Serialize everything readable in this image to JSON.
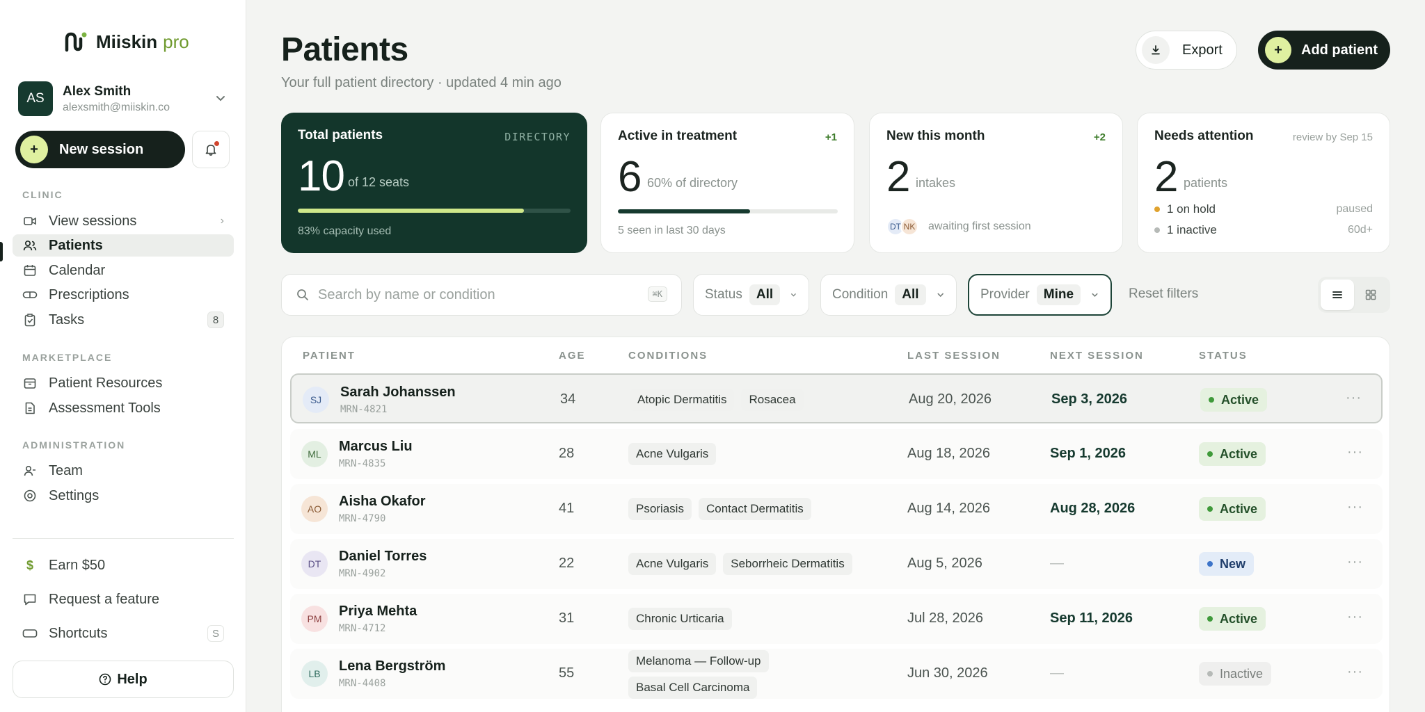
{
  "brand": {
    "name": "Miiskin",
    "suffix": "pro"
  },
  "user": {
    "initials": "AS",
    "name": "Alex Smith",
    "email": "alexsmith@miiskin.co"
  },
  "new_session_label": "New session",
  "nav": {
    "clinic_title": "CLINIC",
    "clinic": [
      {
        "label": "View sessions",
        "icon": "video-icon"
      },
      {
        "label": "Patients",
        "icon": "users-icon"
      },
      {
        "label": "Calendar",
        "icon": "calendar-icon"
      },
      {
        "label": "Prescriptions",
        "icon": "pill-icon"
      },
      {
        "label": "Tasks",
        "icon": "clipboard-icon",
        "count": "8"
      }
    ],
    "marketplace_title": "MARKETPLACE",
    "marketplace": [
      {
        "label": "Patient Resources",
        "icon": "box-icon"
      },
      {
        "label": "Assessment Tools",
        "icon": "document-icon"
      }
    ],
    "admin_title": "ADMINISTRATION",
    "admin": [
      {
        "label": "Team",
        "icon": "user-icon"
      },
      {
        "label": "Settings",
        "icon": "settings-icon"
      }
    ],
    "footer": [
      {
        "label": "Earn $50",
        "icon": "dollar-icon"
      },
      {
        "label": "Request a feature",
        "icon": "message-icon"
      },
      {
        "label": "Shortcuts",
        "icon": "keyboard-icon",
        "key": "S"
      }
    ],
    "help_label": "Help"
  },
  "header": {
    "title": "Patients",
    "subtitle": "Your full patient directory · updated 4 min ago",
    "export_label": "Export",
    "add_label": "Add patient"
  },
  "cards": {
    "total": {
      "title": "Total patients",
      "tag": "DIRECTORY",
      "value": "10",
      "sub": "of 12 seats",
      "foot": "83% capacity used",
      "progress": 0.83
    },
    "active": {
      "title": "Active in treatment",
      "tag": "+1",
      "value": "6",
      "sub": "60% of directory",
      "foot": "5 seen in last 30 days",
      "progress": 0.6
    },
    "new": {
      "title": "New this month",
      "tag": "+2",
      "value": "2",
      "sub": "intakes",
      "avatars": [
        "DT",
        "NK"
      ],
      "foot": "awaiting first session"
    },
    "attention": {
      "title": "Needs attention",
      "tag": "review by Sep 15",
      "value": "2",
      "sub": "patients",
      "rows": [
        {
          "label": "1 on hold",
          "right": "paused"
        },
        {
          "label": "1 inactive",
          "right": "60d+"
        }
      ]
    }
  },
  "filters": {
    "search_placeholder": "Search by name or condition",
    "search_kbd": "⌘K",
    "status_label": "Status",
    "status_value": "All",
    "condition_label": "Condition",
    "condition_value": "All",
    "provider_label": "Provider",
    "provider_value": "Mine",
    "reset_label": "Reset filters"
  },
  "table": {
    "columns": {
      "patient": "PATIENT",
      "age": "AGE",
      "conditions": "CONDITIONS",
      "last": "LAST SESSION",
      "next": "NEXT SESSION",
      "status": "STATUS"
    },
    "rows": [
      {
        "initials": "SJ",
        "name": "Sarah Johanssen",
        "mrn": "MRN-4821",
        "age": "34",
        "conditions": [
          "Atopic Dermatitis",
          "Rosacea"
        ],
        "last": "Aug 20, 2026",
        "next": "Sep 3, 2026",
        "status": "Active"
      },
      {
        "initials": "ML",
        "name": "Marcus Liu",
        "mrn": "MRN-4835",
        "age": "28",
        "conditions": [
          "Acne Vulgaris"
        ],
        "last": "Aug 18, 2026",
        "next": "Sep 1, 2026",
        "status": "Active"
      },
      {
        "initials": "AO",
        "name": "Aisha Okafor",
        "mrn": "MRN-4790",
        "age": "41",
        "conditions": [
          "Psoriasis",
          "Contact Dermatitis"
        ],
        "last": "Aug 14, 2026",
        "next": "Aug 28, 2026",
        "status": "Active"
      },
      {
        "initials": "DT",
        "name": "Daniel Torres",
        "mrn": "MRN-4902",
        "age": "22",
        "conditions": [
          "Acne Vulgaris",
          "Seborrheic Dermatitis"
        ],
        "last": "Aug 5, 2026",
        "next": "—",
        "status": "New"
      },
      {
        "initials": "PM",
        "name": "Priya Mehta",
        "mrn": "MRN-4712",
        "age": "31",
        "conditions": [
          "Chronic Urticaria"
        ],
        "last": "Jul 28, 2026",
        "next": "Sep 11, 2026",
        "status": "Active"
      },
      {
        "initials": "LB",
        "name": "Lena Bergström",
        "mrn": "MRN-4408",
        "age": "55",
        "conditions": [
          "Melanoma — Follow-up",
          "Basal Cell Carcinoma"
        ],
        "last": "Jun 30, 2026",
        "next": "—",
        "status": "Inactive"
      }
    ]
  },
  "colors": {
    "brand_dark": "#13362b",
    "accent_lime": "#dff0a0",
    "active_green": "#3f9a3a",
    "new_blue": "#3c74c9"
  }
}
